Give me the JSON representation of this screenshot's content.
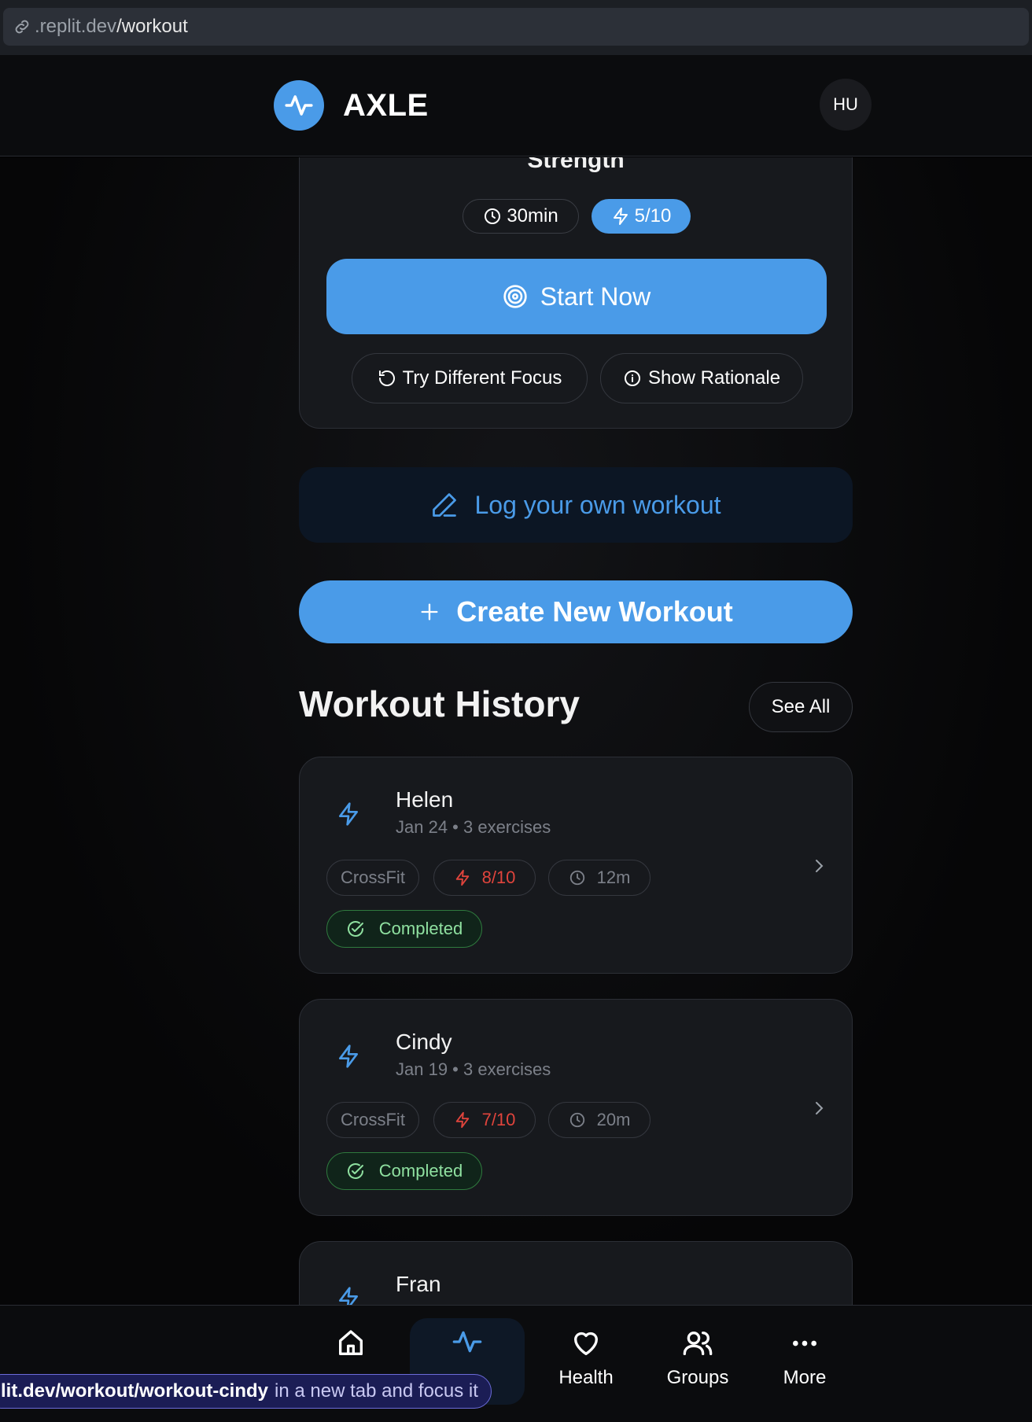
{
  "browser": {
    "url_domain": ".replit.dev",
    "url_path": "/workout"
  },
  "header": {
    "app_name": "AXLE",
    "avatar_initials": "HU"
  },
  "recommended": {
    "title": "Strength",
    "duration": "30min",
    "intensity": "5/10",
    "start_label": "Start Now",
    "try_label": "Try Different Focus",
    "rationale_label": "Show Rationale"
  },
  "actions": {
    "log_label": "Log your own workout",
    "create_label": "Create New Workout"
  },
  "history": {
    "title": "Workout History",
    "see_all": "See All",
    "items": [
      {
        "name": "Helen",
        "meta": "Jan 24 • 3 exercises",
        "type": "CrossFit",
        "intensity": "8/10",
        "duration": "12m",
        "status": "Completed"
      },
      {
        "name": "Cindy",
        "meta": "Jan 19 • 3 exercises",
        "type": "CrossFit",
        "intensity": "7/10",
        "duration": "20m",
        "status": "Completed"
      },
      {
        "name": "Fran"
      }
    ]
  },
  "nav": {
    "items": [
      {
        "label": "Home",
        "icon": "home-icon"
      },
      {
        "label": "Workout",
        "icon": "activity-icon"
      },
      {
        "label": "Health",
        "icon": "heart-icon"
      },
      {
        "label": "Groups",
        "icon": "users-icon"
      },
      {
        "label": "More",
        "icon": "more-icon"
      }
    ]
  },
  "tooltip": {
    "link": "lit.dev/workout/workout-cindy",
    "rest": "in a new tab and focus it"
  },
  "colors": {
    "accent": "#4a9be8",
    "intensity_red": "#e0443c",
    "completed_green": "#8fe0a0"
  }
}
